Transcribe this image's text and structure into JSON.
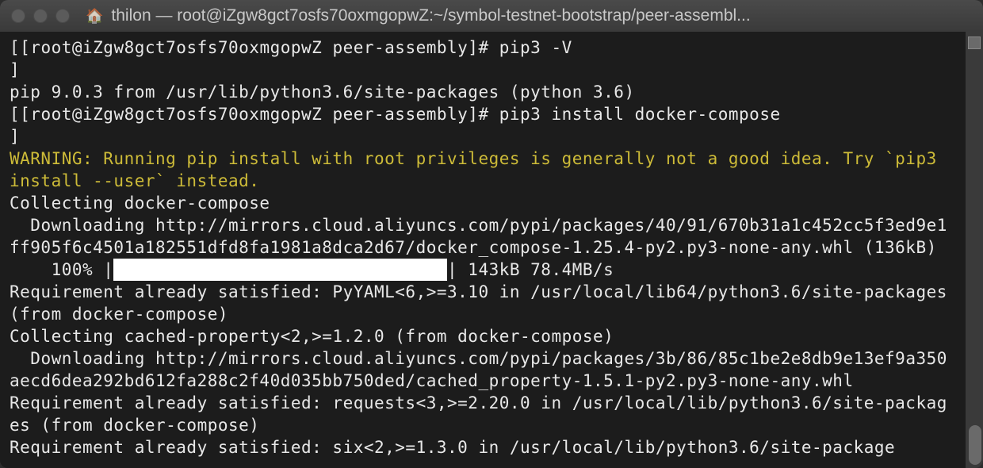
{
  "window": {
    "title": "thilon — root@iZgw8gct7osfs70oxmgopwZ:~/symbol-testnet-bootstrap/peer-assembl..."
  },
  "terminal": {
    "prompt1_l": "[",
    "prompt1_body": "[root@iZgw8gct7osfs70oxmgopwZ peer-assembly]# ",
    "prompt1_r": "]",
    "cmd1": "pip3 -V",
    "out1": "pip 9.0.3 from /usr/lib/python3.6/site-packages (python 3.6)",
    "prompt2_l": "[",
    "prompt2_body": "[root@iZgw8gct7osfs70oxmgopwZ peer-assembly]# ",
    "prompt2_r": "]",
    "cmd2": "pip3 install docker-compose",
    "warn1": "WARNING: Running pip install with root privileges is generally not a good idea. Try `pip3 install --user` instead.",
    "line_collect1": "Collecting docker-compose",
    "line_dl1": "  Downloading http://mirrors.cloud.aliyuncs.com/pypi/packages/40/91/670b31a1c452cc5f3ed9e1ff905f6c4501a182551dfd8fa1981a8dca2d67/docker_compose-1.25.4-py2.py3-none-any.whl (136kB)",
    "progress_prefix": "    100% |",
    "progress_fill": "████████████████████████████████",
    "progress_suffix": "| 143kB 78.4MB/s",
    "line_req1": "Requirement already satisfied: PyYAML<6,>=3.10 in /usr/local/lib64/python3.6/site-packages (from docker-compose)",
    "line_collect2": "Collecting cached-property<2,>=1.2.0 (from docker-compose)",
    "line_dl2": "  Downloading http://mirrors.cloud.aliyuncs.com/pypi/packages/3b/86/85c1be2e8db9e13ef9a350aecd6dea292bd612fa288c2f40d035bb750ded/cached_property-1.5.1-py2.py3-none-any.whl",
    "line_req2": "Requirement already satisfied: requests<3,>=2.20.0 in /usr/local/lib/python3.6/site-packages (from docker-compose)",
    "line_req3": "Requirement already satisfied: six<2,>=1.3.0 in /usr/local/lib/python3.6/site-package"
  }
}
